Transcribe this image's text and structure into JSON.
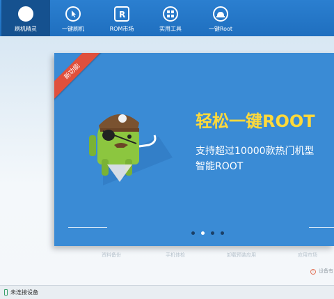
{
  "toolbar": {
    "items": [
      {
        "label": "刷机精灵",
        "icon": "shield-logo-icon",
        "active": true
      },
      {
        "label": "一键刷机",
        "icon": "cursor-icon"
      },
      {
        "label": "ROM市场",
        "icon": "rom-r-icon"
      },
      {
        "label": "实用工具",
        "icon": "grid-icon"
      },
      {
        "label": "一键Root",
        "icon": "android-root-icon"
      }
    ]
  },
  "banner": {
    "ribbon": "新功能",
    "headline": "轻松一键ROOT",
    "line1": "支持超过10000款热门机型",
    "line2": "智能ROOT",
    "dots_total": 4,
    "dots_active": 1
  },
  "shortcuts": [
    "资料备份",
    "手机体检",
    "卸载预装应用",
    "应用市场"
  ],
  "warning": {
    "text": "设备有"
  },
  "status": {
    "text": "未连接设备"
  },
  "colors": {
    "toolbar": "#1f6fbf",
    "banner": "#3a8bd5",
    "headline": "#ffd93a",
    "ribbon": "#e0503c"
  }
}
